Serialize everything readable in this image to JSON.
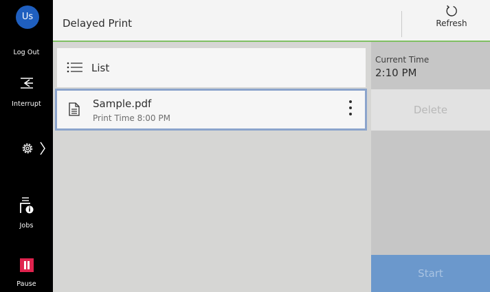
{
  "sidebar": {
    "avatar": "Us",
    "logout_label": "Log Out",
    "interrupt_label": "Interrupt",
    "jobs_label": "Jobs",
    "pause_label": "Pause"
  },
  "header": {
    "title": "Delayed Print",
    "refresh_label": "Refresh"
  },
  "main": {
    "list_label": "List",
    "files": [
      {
        "name": "Sample.pdf",
        "print_time": "Print Time 8:00 PM"
      }
    ]
  },
  "right_panel": {
    "current_time_label": "Current Time",
    "current_time_value": "2:10 PM",
    "delete_label": "Delete",
    "start_label": "Start"
  },
  "colors": {
    "sidebar_bg": "#000000",
    "avatar": "#1f5fbf",
    "pause": "#e0234e",
    "header_accent": "#7fbf62",
    "selection_border": "#8ba4cc",
    "start_button": "#6b98cc"
  },
  "icons": [
    "user-avatar",
    "interrupt-icon",
    "gear-icon",
    "chevron-right-icon",
    "jobs-icon",
    "pause-icon",
    "refresh-icon",
    "list-icon",
    "document-icon",
    "kebab-menu-icon"
  ]
}
